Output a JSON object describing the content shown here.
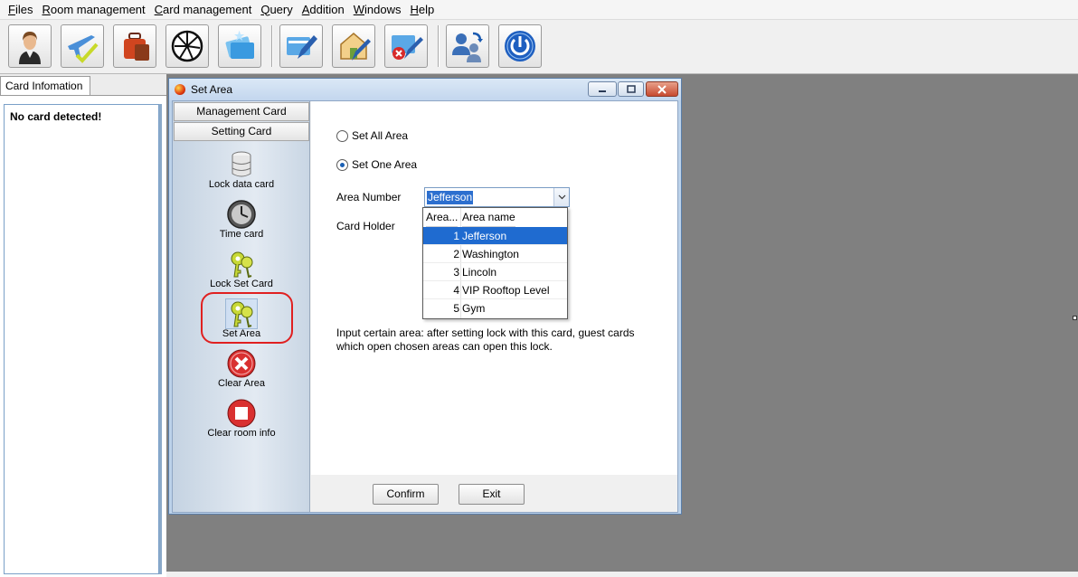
{
  "menu": [
    {
      "label": "Files",
      "mn": "F",
      "rest": "iles"
    },
    {
      "label": "Room management",
      "mn": "R",
      "rest": "oom management"
    },
    {
      "label": "Card management",
      "mn": "C",
      "rest": "ard management"
    },
    {
      "label": "Query",
      "mn": "Q",
      "rest": "uery"
    },
    {
      "label": "Addition",
      "mn": "A",
      "rest": "ddition"
    },
    {
      "label": "Windows",
      "mn": "W",
      "rest": "indows"
    },
    {
      "label": "Help",
      "mn": "H",
      "rest": "elp"
    }
  ],
  "toolbar": {
    "icons": [
      "user-icon",
      "flight-check-icon",
      "luggage-icon",
      "fan-icon",
      "cards-icon",
      "edit-card-icon",
      "house-edit-icon",
      "card-cancel-icon",
      "switch-user-icon",
      "power-icon"
    ]
  },
  "left_panel": {
    "tab_label": "Card Infomation",
    "status": "No card detected!"
  },
  "dialog": {
    "title": "Set Area",
    "nav_tabs": {
      "management": "Management Card",
      "setting": "Setting Card"
    },
    "nav_items": [
      {
        "label": "Lock data card",
        "icon": "database-icon"
      },
      {
        "label": "Time card",
        "icon": "clock-icon"
      },
      {
        "label": "Lock Set Card",
        "icon": "keys-icon"
      },
      {
        "label": "Set Area",
        "icon": "keys-icon"
      },
      {
        "label": "Clear Area",
        "icon": "clear-x-icon"
      },
      {
        "label": "Clear room info",
        "icon": "stop-icon"
      }
    ],
    "options": {
      "set_all": "Set All Area",
      "set_one": "Set One Area",
      "selected": "set_one"
    },
    "area_number_label": "Area Number",
    "area_number_value": "Jefferson",
    "card_holder_label": "Card Holder",
    "dropdown": {
      "col_num": "Area...",
      "col_name": "Area name",
      "rows": [
        {
          "num": "1",
          "name": "Jefferson"
        },
        {
          "num": "2",
          "name": "Washington"
        },
        {
          "num": "3",
          "name": "Lincoln"
        },
        {
          "num": "4",
          "name": "VIP Rooftop Level"
        },
        {
          "num": "5",
          "name": "Gym"
        }
      ],
      "selected_index": 0
    },
    "description": "Input certain area: after setting lock with this card, guest cards which open chosen areas can open this lock.",
    "confirm_label": "Confirm",
    "exit_label": "Exit"
  }
}
